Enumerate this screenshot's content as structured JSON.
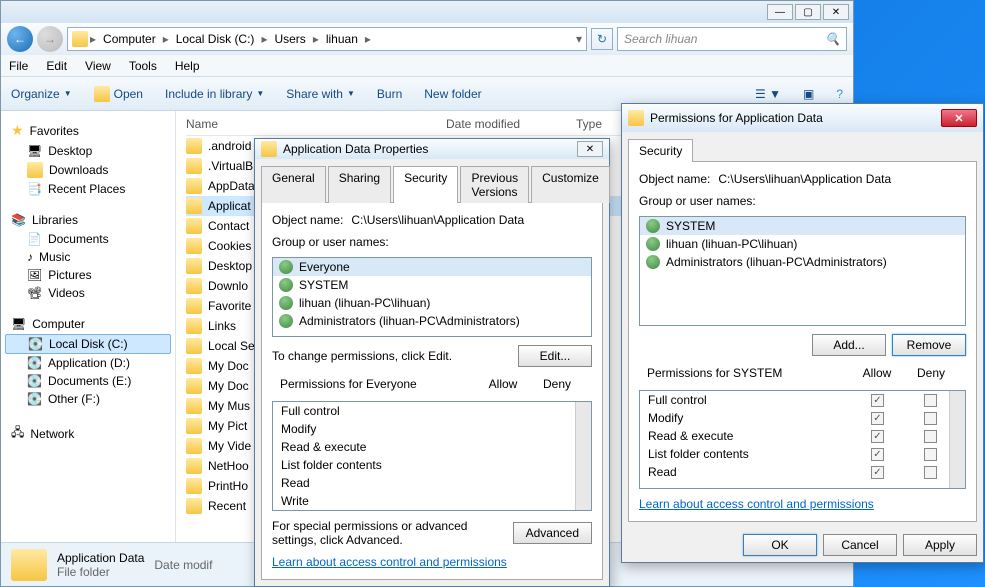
{
  "explorer": {
    "breadcrumbs": [
      "Computer",
      "Local Disk (C:)",
      "Users",
      "lihuan"
    ],
    "search_placeholder": "Search lihuan",
    "menubar": [
      "File",
      "Edit",
      "View",
      "Tools",
      "Help"
    ],
    "toolbar": {
      "organize": "Organize",
      "open": "Open",
      "include": "Include in library",
      "share": "Share with",
      "burn": "Burn",
      "newfolder": "New folder"
    },
    "sidebar": {
      "favorites": {
        "label": "Favorites",
        "items": [
          "Desktop",
          "Downloads",
          "Recent Places"
        ]
      },
      "libraries": {
        "label": "Libraries",
        "items": [
          "Documents",
          "Music",
          "Pictures",
          "Videos"
        ]
      },
      "computer": {
        "label": "Computer",
        "items": [
          "Local Disk (C:)",
          "Application (D:)",
          "Documents (E:)",
          "Other (F:)"
        ]
      },
      "network": {
        "label": "Network"
      }
    },
    "columns": {
      "name": "Name",
      "date": "Date modified",
      "type": "Type"
    },
    "files": [
      ".android",
      ".VirtualB",
      "AppData",
      "Applicat",
      "Contact",
      "Cookies",
      "Desktop",
      "Downlo",
      "Favorite",
      "Links",
      "Local Se",
      "My Doc",
      "My Doc",
      "My Mus",
      "My Pict",
      "My Vide",
      "NetHoo",
      "PrintHo",
      "Recent"
    ],
    "status": {
      "name": "Application Data",
      "sub": "File folder",
      "detail": "Date modif"
    }
  },
  "propsDialog": {
    "title": "Application Data Properties",
    "tabs": [
      "General",
      "Sharing",
      "Security",
      "Previous Versions",
      "Customize"
    ],
    "objectLabel": "Object name:",
    "objectPath": "C:\\Users\\lihuan\\Application Data",
    "groupLabel": "Group or user names:",
    "users": [
      "Everyone",
      "SYSTEM",
      "lihuan (lihuan-PC\\lihuan)",
      "Administrators (lihuan-PC\\Administrators)"
    ],
    "changeText": "To change permissions, click Edit.",
    "editBtn": "Edit...",
    "permFor": "Permissions for Everyone",
    "allow": "Allow",
    "deny": "Deny",
    "perms": [
      "Full control",
      "Modify",
      "Read & execute",
      "List folder contents",
      "Read",
      "Write"
    ],
    "advText": "For special permissions or advanced settings, click Advanced.",
    "advBtn": "Advanced",
    "learnLink": "Learn about access control and permissions"
  },
  "permDialog": {
    "title": "Permissions for Application Data",
    "tab": "Security",
    "objectLabel": "Object name:",
    "objectPath": "C:\\Users\\lihuan\\Application Data",
    "groupLabel": "Group or user names:",
    "users": [
      "SYSTEM",
      "lihuan (lihuan-PC\\lihuan)",
      "Administrators (lihuan-PC\\Administrators)"
    ],
    "addBtn": "Add...",
    "removeBtn": "Remove",
    "permFor": "Permissions for SYSTEM",
    "allow": "Allow",
    "deny": "Deny",
    "perms": [
      "Full control",
      "Modify",
      "Read & execute",
      "List folder contents",
      "Read"
    ],
    "learnLink": "Learn about access control and permissions",
    "ok": "OK",
    "cancel": "Cancel",
    "apply": "Apply"
  }
}
